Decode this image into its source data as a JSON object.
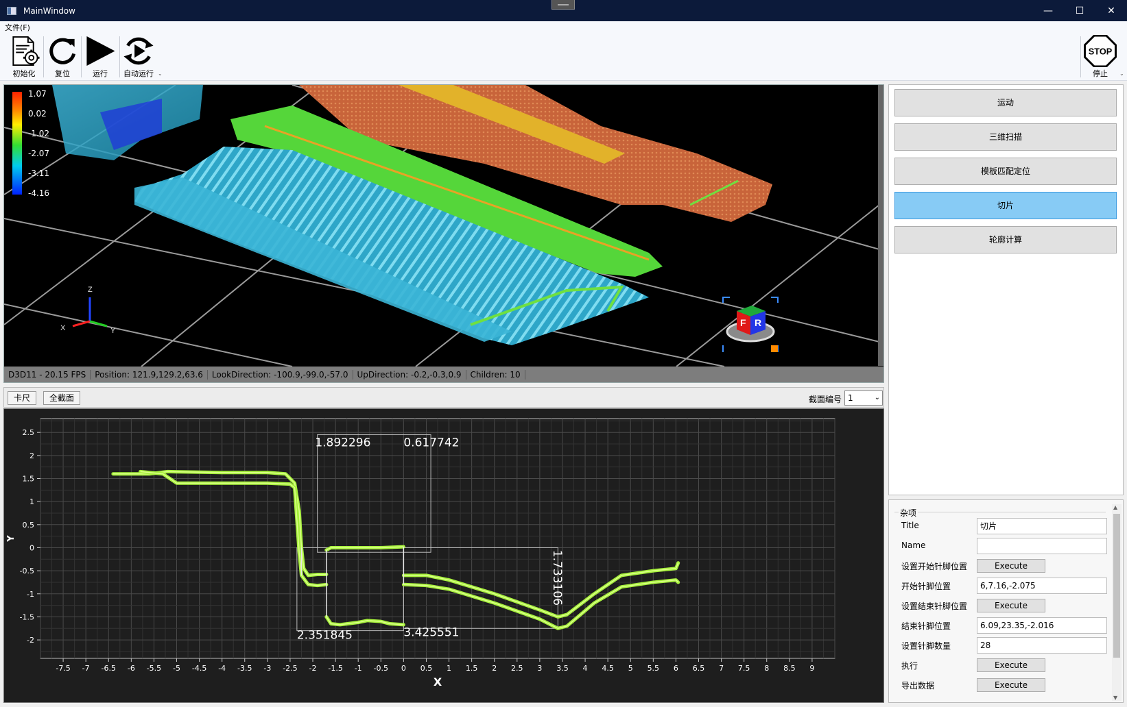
{
  "window": {
    "title": "MainWindow",
    "minimize": "—",
    "maximize": "☐",
    "close": "✕"
  },
  "menu": {
    "file": "文件(F)"
  },
  "toolbar": {
    "init": "初始化",
    "reset": "复位",
    "run": "运行",
    "auto_run": "自动运行",
    "stop": "停止",
    "stop_sign": "STOP",
    "overflow": "⌄"
  },
  "viewport": {
    "colorbar_labels": [
      "1.07",
      "0.02",
      "-1.02",
      "-2.07",
      "-3.11",
      "-4.16"
    ],
    "axes": {
      "x": "X",
      "y": "Y",
      "z": "Z"
    },
    "cube_faces": {
      "front": "F",
      "right": "R"
    },
    "status": {
      "fps": "D3D11 - 20.15 FPS",
      "position": "Position: 121.9,129.2,63.6",
      "look": "LookDirection: -100.9,-99.0,-57.0",
      "up": "UpDirection: -0.2,-0.3,0.9",
      "children": "Children: 10"
    }
  },
  "tabs": {
    "caliper": "卡尺",
    "full_section": "全截面",
    "section_label": "截面编号",
    "section_value": "1",
    "arrow": "⌄"
  },
  "steps": [
    {
      "label": "运动",
      "active": false
    },
    {
      "label": "三维扫描",
      "active": false
    },
    {
      "label": "模板匹配定位",
      "active": false
    },
    {
      "label": "切片",
      "active": true
    },
    {
      "label": "轮廓计算",
      "active": false
    }
  ],
  "props": {
    "group": "杂项",
    "rows": [
      {
        "name": "Title",
        "type": "text",
        "value": "切片"
      },
      {
        "name": "Name",
        "type": "text",
        "value": ""
      },
      {
        "name": "设置开始针脚位置",
        "type": "button",
        "value": "Execute"
      },
      {
        "name": "开始针脚位置",
        "type": "text",
        "value": "6,7.16,-2.075"
      },
      {
        "name": "设置结束针脚位置",
        "type": "button",
        "value": "Execute"
      },
      {
        "name": "结束针脚位置",
        "type": "text",
        "value": "6.09,23.35,-2.016"
      },
      {
        "name": "设置针脚数量",
        "type": "text",
        "value": "28"
      },
      {
        "name": "执行",
        "type": "button",
        "value": "Execute"
      },
      {
        "name": "导出数据",
        "type": "button",
        "value": "Execute"
      }
    ]
  },
  "chart_data": {
    "type": "line",
    "xlabel": "X",
    "ylabel": "Y",
    "xlim": [
      -8,
      9.5
    ],
    "ylim": [
      -2.4,
      2.8
    ],
    "x_ticks": [
      -7.5,
      -7,
      -6.5,
      -6,
      -5.5,
      -5,
      -4.5,
      -4,
      -3.5,
      -3,
      -2.5,
      -2,
      -1.5,
      -1,
      -0.5,
      0,
      0.5,
      1,
      1.5,
      2,
      2.5,
      3,
      3.5,
      4,
      4.5,
      5,
      5.5,
      6,
      6.5,
      7,
      7.5,
      8,
      8.5,
      9
    ],
    "y_ticks": [
      2.5,
      2,
      1.5,
      1,
      0.5,
      0,
      -0.5,
      -1,
      -1.5,
      -2
    ],
    "series": [
      {
        "x": [
          -6.4,
          -5.6,
          -5.2,
          -4,
          -3,
          -2.6,
          -2.4,
          -2.3,
          -2.25,
          -2.2,
          -2.1,
          -1.9,
          -1.7
        ],
        "y": [
          1.6,
          1.6,
          1.65,
          1.63,
          1.63,
          1.6,
          1.4,
          0.8,
          0.0,
          -0.45,
          -0.6,
          -0.58,
          -0.58
        ]
      },
      {
        "x": [
          -5.8,
          -5.3,
          -5,
          -4,
          -3,
          -2.5,
          -2.4,
          -2.35,
          -2.3,
          -2.25,
          -2.1,
          -1.9,
          -1.7
        ],
        "y": [
          1.65,
          1.6,
          1.4,
          1.4,
          1.4,
          1.38,
          1.3,
          0.6,
          -0.1,
          -0.6,
          -0.8,
          -0.82,
          -0.8
        ]
      },
      {
        "x": [
          -1.7,
          -1.6,
          -1.4,
          -1,
          -0.5,
          0
        ],
        "y": [
          -0.05,
          0.0,
          0.0,
          0.0,
          0.0,
          0.02
        ]
      },
      {
        "x": [
          -1.7,
          -1.6,
          -1.4,
          -1,
          -0.8,
          -0.5,
          -0.3,
          0
        ],
        "y": [
          -1.5,
          -1.65,
          -1.67,
          -1.62,
          -1.58,
          -1.6,
          -1.65,
          -1.67
        ]
      },
      {
        "x": [
          0,
          0.5,
          1,
          2,
          3,
          3.4,
          3.6,
          4.2,
          4.8,
          5.5,
          6,
          6.05
        ],
        "y": [
          -0.6,
          -0.6,
          -0.7,
          -1.0,
          -1.35,
          -1.5,
          -1.45,
          -1.0,
          -0.6,
          -0.5,
          -0.45,
          -0.33
        ]
      },
      {
        "x": [
          0,
          0.5,
          1,
          2,
          3,
          3.4,
          3.6,
          4.2,
          4.8,
          5.5,
          6,
          6.05
        ],
        "y": [
          -0.8,
          -0.82,
          -0.9,
          -1.2,
          -1.55,
          -1.75,
          -1.7,
          -1.2,
          -0.85,
          -0.75,
          -0.7,
          -0.75
        ]
      }
    ],
    "annotations": [
      {
        "text": "1.892296",
        "x": -1.95,
        "y": 2.2
      },
      {
        "text": "0.617742",
        "x": 0.0,
        "y": 2.2
      },
      {
        "text": "1.733106",
        "x": 3.3,
        "y": -0.05
      },
      {
        "text": "2.351845",
        "x": -2.35,
        "y": -1.98
      },
      {
        "text": "3.425551",
        "x": 0.0,
        "y": -1.92
      }
    ],
    "boxes": [
      {
        "x1": -1.9,
        "x2": 0.6,
        "y1": -0.1,
        "y2": 2.45
      },
      {
        "x1": -2.35,
        "x2": 0.0,
        "y1": -1.8,
        "y2": 0.0
      },
      {
        "x1": 0.0,
        "x2": 3.4,
        "y1": -1.75,
        "y2": 0.0
      }
    ]
  }
}
